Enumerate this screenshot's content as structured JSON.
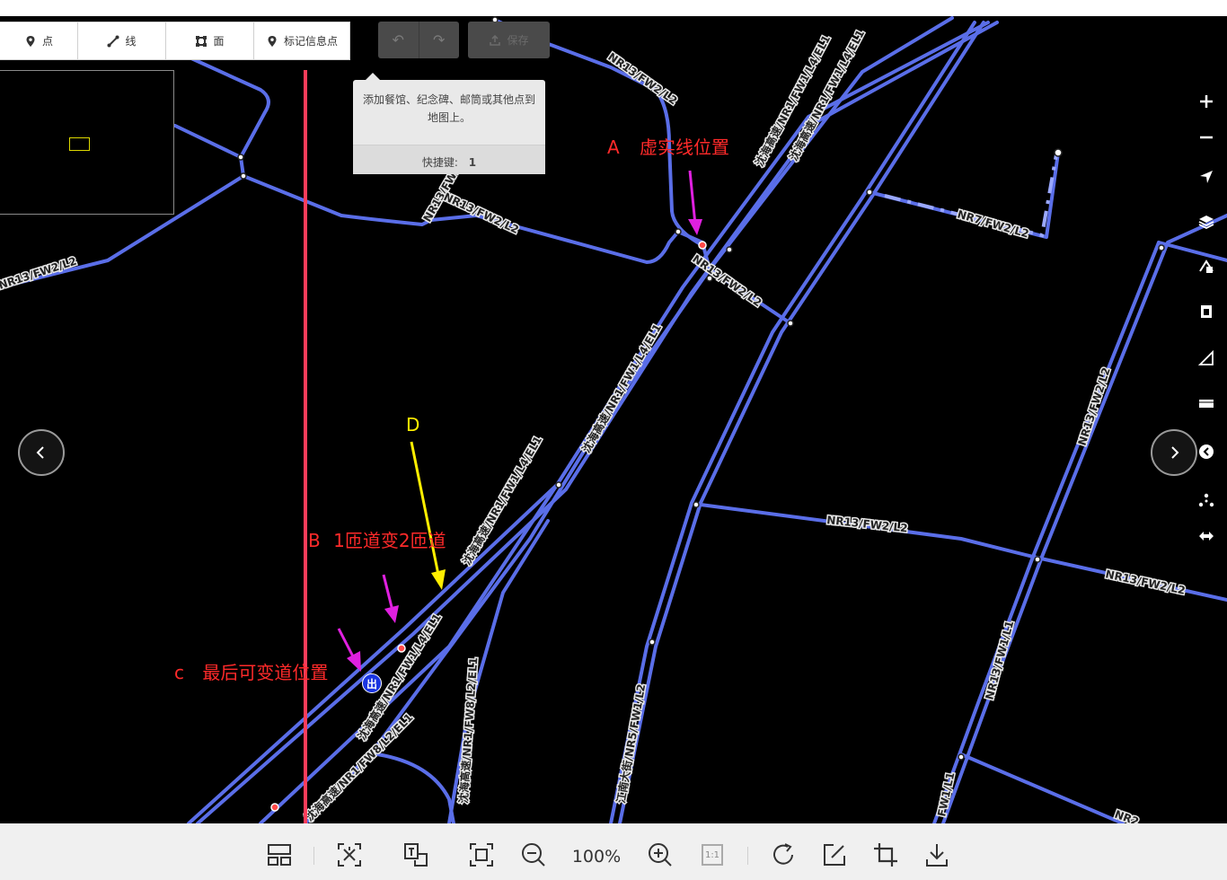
{
  "toolbar": {
    "point_label": "点",
    "line_label": "线",
    "area_label": "面",
    "marker_label": "标记信息点",
    "save_label": "保存"
  },
  "tooltip": {
    "text": "添加餐馆、纪念碑、邮筒或其他点到地图上。",
    "shortcut_label": "快捷键:",
    "shortcut_key": "1"
  },
  "road_labels": [
    "NR13/FW2/L2",
    "NR13/FW2/L2",
    "NR13/FW2/L2",
    "NR13/FW2/L2",
    "NR13/FW2/L2",
    "NR13/FW2/L2",
    "NR13/FW2/L2",
    "NR13/FW2/L2",
    "NR7/FW2/L2",
    "沈海高速/NR1/FW1/L4/EL1",
    "沈海高速/NR1/FW1/L4/EL1",
    "沈海高速/NR1/FW1/L4/EL1",
    "沈海高速/NR1/FW1/L4/EL1",
    "沈海高速/NR1/FW1/L4/EL1",
    "沈海高速/NR1/FW8/L2/EL1",
    "沈海高速/NR1/FW8/L2/EL1",
    "江南大街/NR5/FW1/L2",
    "NR13/FW1/L1",
    "FW1/L1",
    "NR2"
  ],
  "annotations": {
    "a_letter": "A",
    "a_text": "虚实线位置",
    "b_letter": "B",
    "b_text": "1匝道变2匝道",
    "c_letter": "c",
    "c_text": "最后可变道位置",
    "d_letter": "D"
  },
  "exit_badge": "出",
  "bottom": {
    "zoom": "100%",
    "one_to_one": "1:1"
  },
  "colors": {
    "map_bg": "#000000",
    "road": "#5a6ee8",
    "annotation_red": "#ff2a2a",
    "annotation_yellow": "#ffee00",
    "arrow_magenta": "#e020e0",
    "vertical_line": "#ff3c5a"
  },
  "icons": [
    "map-pin-icon",
    "line-icon",
    "area-icon",
    "marker-icon",
    "undo-icon",
    "redo-icon",
    "upload-icon",
    "zoom-in-icon",
    "zoom-out-icon",
    "locate-icon",
    "layers-icon",
    "map-data-icon",
    "issues-icon",
    "preferences-icon",
    "help-icon",
    "measure-icon",
    "history-icon",
    "back-icon",
    "forward-icon",
    "swap-icon"
  ]
}
